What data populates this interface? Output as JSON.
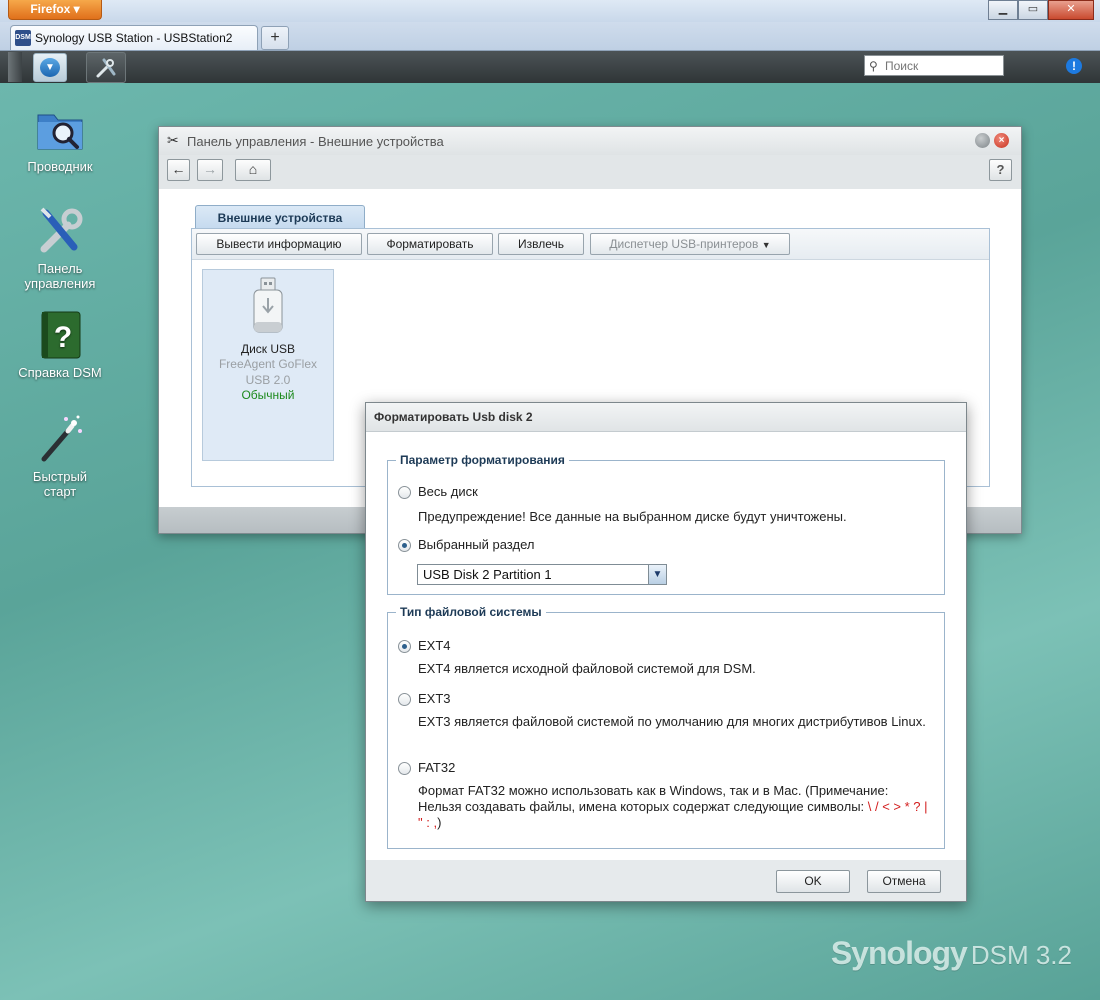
{
  "browser": {
    "menu_label": "Firefox",
    "tab_title": "Synology USB Station - USBStation2",
    "tab_favicon_text": "DSM",
    "new_tab_label": "+",
    "window_buttons": {
      "minimize": "▁",
      "maximize": "▭",
      "close": "✕"
    }
  },
  "taskbar": {
    "search_placeholder": "Поиск",
    "main_menu_icon": "chevron-down-icon",
    "control_panel_icon": "tools-icon"
  },
  "desktop": {
    "icons": [
      {
        "label": "Проводник",
        "icon": "file-browser-icon"
      },
      {
        "label": "Панель управления",
        "icon": "control-panel-icon"
      },
      {
        "label": "Справка DSM",
        "icon": "help-icon"
      },
      {
        "label": "Быстрый старт",
        "icon": "quick-start-icon"
      }
    ],
    "brand": {
      "name": "Synology",
      "version": "DSM 3.2"
    }
  },
  "control_panel": {
    "title": "Панель управления - Внешние устройства",
    "help_label": "?",
    "tab_label": "Внешние устройства",
    "toolbar": {
      "info_label": "Вывести информацию",
      "format_label": "Форматировать",
      "eject_label": "Извлечь",
      "printer_label": "Диспетчер USB-принтеров"
    },
    "device": {
      "name": "Диск USB",
      "model": "FreeAgent GoFlex USB 2.0",
      "status": "Обычный"
    }
  },
  "format_dialog": {
    "title": "Форматировать Usb disk 2",
    "format_group": {
      "legend": "Параметр форматирования",
      "whole_disk_label": "Весь диск",
      "whole_disk_warning": "Предупреждение! Все данные на выбранном диске будут уничтожены.",
      "partition_label": "Выбранный раздел",
      "partition_value": "USB Disk 2 Partition 1",
      "selected": "partition"
    },
    "fs_group": {
      "legend": "Тип файловой системы",
      "selected": "EXT4",
      "ext4_label": "EXT4",
      "ext4_desc": "EXT4 является исходной файловой системой для DSM.",
      "ext3_label": "EXT3",
      "ext3_desc": "EXT3 является файловой системой по умолчанию для многих дистрибутивов Linux.",
      "fat32_label": "FAT32",
      "fat32_desc": "Формат FAT32 можно использовать как в Windows, так и в Mac. (Примечание: Нельзя создавать файлы, имена которых содержат следующие символы: ",
      "fat32_chars": "\\ / < > * ? | \" : ,",
      "fat32_desc_end": ")"
    },
    "ok_label": "OK",
    "cancel_label": "Отмена"
  }
}
